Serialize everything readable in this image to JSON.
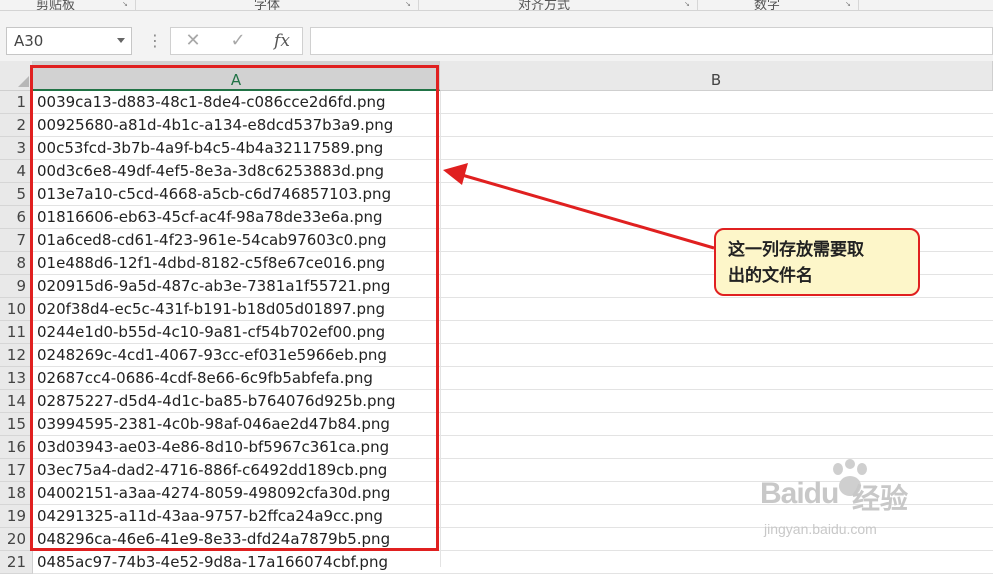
{
  "ribbon": {
    "groups": [
      "剪贴板",
      "字体",
      "对齐方式",
      "数字"
    ]
  },
  "formula_bar": {
    "name_box": "A30",
    "cancel_icon": "close-icon",
    "enter_icon": "check-icon",
    "function_label": "fx",
    "formula_value": ""
  },
  "sheet": {
    "columns": [
      "A",
      "B"
    ],
    "selected_column": "A",
    "rows": [
      {
        "num": "1",
        "a": "0039ca13-d883-48c1-8de4-c086cce2d6fd.png"
      },
      {
        "num": "2",
        "a": "00925680-a81d-4b1c-a134-e8dcd537b3a9.png"
      },
      {
        "num": "3",
        "a": "00c53fcd-3b7b-4a9f-b4c5-4b4a32117589.png"
      },
      {
        "num": "4",
        "a": "00d3c6e8-49df-4ef5-8e3a-3d8c6253883d.png"
      },
      {
        "num": "5",
        "a": "013e7a10-c5cd-4668-a5cb-c6d746857103.png"
      },
      {
        "num": "6",
        "a": "01816606-eb63-45cf-ac4f-98a78de33e6a.png"
      },
      {
        "num": "7",
        "a": "01a6ced8-cd61-4f23-961e-54cab97603c0.png"
      },
      {
        "num": "8",
        "a": "01e488d6-12f1-4dbd-8182-c5f8e67ce016.png"
      },
      {
        "num": "9",
        "a": "020915d6-9a5d-487c-ab3e-7381a1f55721.png"
      },
      {
        "num": "10",
        "a": "020f38d4-ec5c-431f-b191-b18d05d01897.png"
      },
      {
        "num": "11",
        "a": "0244e1d0-b55d-4c10-9a81-cf54b702ef00.png"
      },
      {
        "num": "12",
        "a": "0248269c-4cd1-4067-93cc-ef031e5966eb.png"
      },
      {
        "num": "13",
        "a": "02687cc4-0686-4cdf-8e66-6c9fb5abfefa.png"
      },
      {
        "num": "14",
        "a": "02875227-d5d4-4d1c-ba85-b764076d925b.png"
      },
      {
        "num": "15",
        "a": "03994595-2381-4c0b-98af-046ae2d47b84.png"
      },
      {
        "num": "16",
        "a": "03d03943-ae03-4e86-8d10-bf5967c361ca.png"
      },
      {
        "num": "17",
        "a": "03ec75a4-dad2-4716-886f-c6492dd189cb.png"
      },
      {
        "num": "18",
        "a": "04002151-a3aa-4274-8059-498092cfa30d.png"
      },
      {
        "num": "19",
        "a": "04291325-a11d-43aa-9757-b2ffca24a9cc.png"
      },
      {
        "num": "20",
        "a": "048296ca-46e6-41e9-8e33-dfd24a7879b5.png"
      },
      {
        "num": "21",
        "a": "0485ac97-74b3-4e52-9d8a-17a166074cbf.png"
      }
    ]
  },
  "annotation": {
    "callout_line1": "这一列存放需要取",
    "callout_line2": "出的文件名",
    "border_color": "#e02020",
    "callout_bg": "#fdf6c9"
  },
  "watermark": {
    "logo_text": "Baidu",
    "product_text": "经验",
    "url": "jingyan.baidu.com"
  }
}
